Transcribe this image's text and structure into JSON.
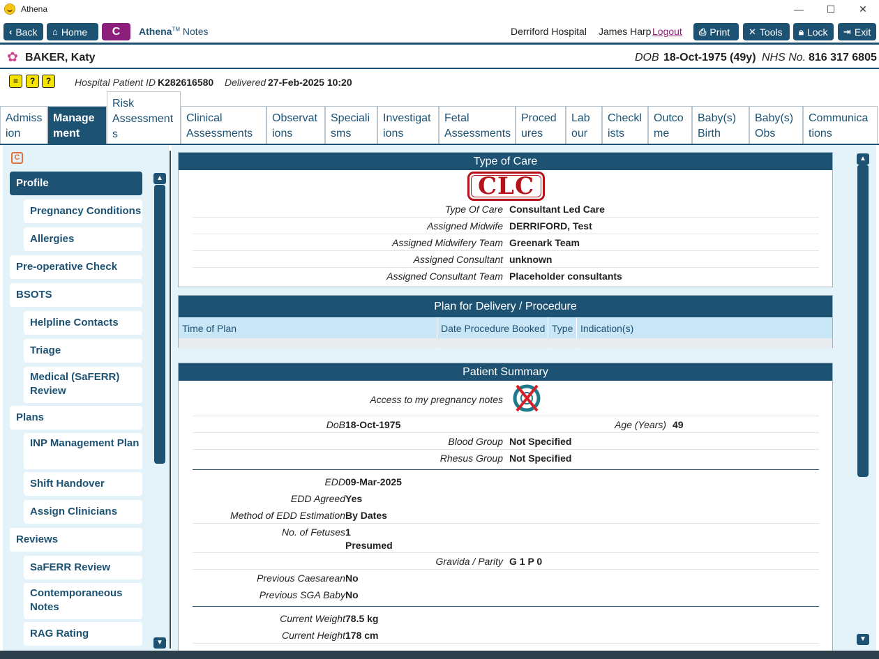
{
  "window": {
    "title": "Athena",
    "minimize": "—",
    "maximize": "☐",
    "close": "✕"
  },
  "toolbar": {
    "back": "Back",
    "home": "Home",
    "c_label": "C",
    "app_name": "Athena",
    "app_tm": "TM",
    "app_suffix": "Notes",
    "hospital": "Derriford Hospital",
    "user": "James Harp",
    "logout": "Logout",
    "print": "Print",
    "tools": "Tools",
    "lock": "Lock",
    "exit": "Exit"
  },
  "patient": {
    "name": "BAKER, Katy",
    "dob_label": "DOB",
    "dob_value": "18-Oct-1975 (49y)",
    "nhs_label": "NHS No.",
    "nhs_value": "816 317 6805",
    "hospital_id_label": "Hospital Patient ID",
    "hospital_id": "K282616580",
    "delivered_label": "Delivered",
    "delivered": "27-Feb-2025 10:20",
    "alerts": [
      "≡",
      "?",
      "?"
    ]
  },
  "tabs": [
    {
      "id": "admission",
      "label": "Admiss ion"
    },
    {
      "id": "management",
      "label": "Manage ment",
      "active": true
    },
    {
      "id": "risk",
      "label": "Risk Assessment s"
    },
    {
      "id": "clinical",
      "label": "Clinical Assessments"
    },
    {
      "id": "observations",
      "label": "Observat ions"
    },
    {
      "id": "specialisms",
      "label": "Speciali sms"
    },
    {
      "id": "investigations",
      "label": "Investigat ions"
    },
    {
      "id": "fetal",
      "label": "Fetal Assessments"
    },
    {
      "id": "procedures",
      "label": "Proced ures"
    },
    {
      "id": "labour",
      "label": "Lab our"
    },
    {
      "id": "checklists",
      "label": "Checkl ists"
    },
    {
      "id": "outcome",
      "label": "Outco me"
    },
    {
      "id": "babys_birth",
      "label": "Baby(s) Birth"
    },
    {
      "id": "babys_obs",
      "label": "Baby(s) Obs"
    },
    {
      "id": "communications",
      "label": "Communica tions"
    }
  ],
  "nav": {
    "c_icon": "C",
    "items": [
      {
        "label": "Profile",
        "level": "top",
        "selected": true
      },
      {
        "label": "Pregnancy Conditions",
        "level": "sub"
      },
      {
        "label": "Allergies",
        "level": "sub"
      },
      {
        "label": "Pre-operative Check",
        "level": "top"
      },
      {
        "label": "BSOTS",
        "level": "top"
      },
      {
        "label": "Helpline Contacts",
        "level": "sub"
      },
      {
        "label": "Triage",
        "level": "sub"
      },
      {
        "label": "Medical (SaFERR) Review",
        "level": "sub"
      },
      {
        "label": "Plans",
        "level": "top"
      },
      {
        "label": "INP Management Plan",
        "level": "sub"
      },
      {
        "label": "Shift Handover",
        "level": "sub"
      },
      {
        "label": "Assign Clinicians",
        "level": "sub"
      },
      {
        "label": "Reviews",
        "level": "top"
      },
      {
        "label": "SaFERR Review",
        "level": "sub"
      },
      {
        "label": "Contemporaneous Notes",
        "level": "sub"
      },
      {
        "label": "RAG Rating",
        "level": "sub"
      }
    ]
  },
  "type_of_care": {
    "header": "Type of Care",
    "stamp": "CLC",
    "rows": [
      {
        "label": "Type Of Care",
        "value": "Consultant Led Care"
      },
      {
        "label": "Assigned Midwife",
        "value": "DERRIFORD, Test"
      },
      {
        "label": "Assigned Midwifery Team",
        "value": "Greenark Team"
      },
      {
        "label": "Assigned Consultant",
        "value": "unknown"
      },
      {
        "label": "Assigned Consultant Team",
        "value": "Placeholder consultants"
      }
    ]
  },
  "plan_delivery": {
    "header": "Plan for Delivery / Procedure",
    "columns": [
      "Time of Plan",
      "Date Procedure Booked",
      "Type",
      "Indication(s)"
    ]
  },
  "summary": {
    "header": "Patient Summary",
    "access_label": "Access to my pregnancy notes",
    "dob_label": "DoB",
    "dob_value": "18-Oct-1975",
    "age_label": "Age (Years)",
    "age_value": "49",
    "blood_group_label": "Blood Group",
    "blood_group_value": "Not Specified",
    "rhesus_label": "Rhesus Group",
    "rhesus_value": "Not Specified",
    "edd_label": "EDD",
    "edd_value": "09-Mar-2025",
    "edd_agreed_label": "EDD Agreed",
    "edd_agreed_value": "Yes",
    "edd_method_label": "Method of EDD Estimation",
    "edd_method_value": "By Dates",
    "fetuses_label": "No. of Fetuses",
    "fetuses_value": "1",
    "fetuses_note": "Presumed",
    "gravida_label": "Gravida / Parity",
    "gravida_value": "G 1 P 0",
    "prev_caesarean_label": "Previous Caesarean",
    "prev_caesarean_value": "No",
    "prev_sga_label": "Previous SGA Baby",
    "prev_sga_value": "No",
    "weight_label": "Current Weight",
    "weight_value": "78.5 kg",
    "height_label": "Current Height",
    "height_value": "178 cm"
  },
  "colors": {
    "primary": "#1d5273",
    "accent": "#8c1f7c",
    "stamp_red": "#b5121b",
    "panel_bg": "#e4f2fa"
  }
}
